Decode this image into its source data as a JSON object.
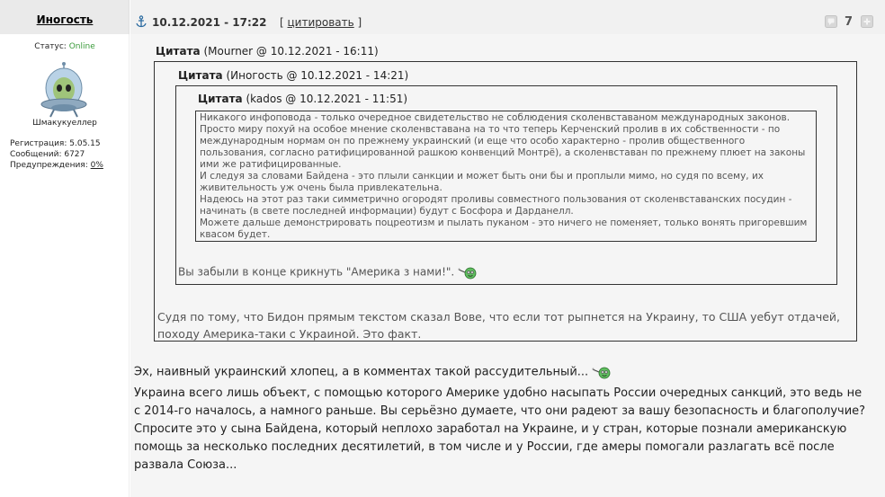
{
  "author": {
    "name": "Иногость",
    "status_label": "Статус:",
    "status_value": "Online",
    "nick": "Шмакукуеллер",
    "reg_label": "Регистрация:",
    "reg_value": "5.05.15",
    "posts_label": "Сообщений:",
    "posts_value": "6727",
    "warn_label": "Предупреждения:",
    "warn_value": "0%"
  },
  "post_header": {
    "date": "10.12.2021 - 17:22",
    "bracket_open": "[",
    "quote_link": "цитировать",
    "bracket_close": "]",
    "rating": "7"
  },
  "quote1": {
    "label": "Цитата",
    "meta": "(Mourner @ 10.12.2021 - 16:11)",
    "text": "Судя по тому, что Бидон прямым текстом сказал Вове, что если тот рыпнется на Украину, то США уебут отдачей, походу Америка-таки с Украиной. Это факт."
  },
  "quote2": {
    "label": "Цитата",
    "meta": "(Иногость @ 10.12.2021 - 14:21)",
    "text": "Вы забыли в конце крикнуть \"Америка з нами!\"."
  },
  "quote3": {
    "label": "Цитата",
    "meta": "(kados @ 10.12.2021 - 11:51)",
    "lines": [
      "Никакого инфоповода - только очередное свидетельство не соблюдения сколенвставаном международных законов.",
      "Просто миру похуй на особое мнение сколенвставана на то что теперь Керченский пролив в их собственности - по международным нормам он по прежнему украинский (и еще что особо характерно - пролив общественного пользования, согласно ратифицированной рашкою конвенций Монтрё), а сколенвставан по прежнему плюет на законы ими же ратифицированные.",
      "И следуя за словами Байдена - это плыли санкции и может быть они бы и проплыли мимо, но судя по всему, их живительность уж очень была привлекательна.",
      "Надеюсь на этот раз таки симметрично огородят проливы совместного пользования от сколенвставанских посудин - начинать (в свете последней информации) будут с Босфора и Дарданелл.",
      "Можете дальше демонстрировать поцреотизм и пылать пуканом - это ничего не поменяет, только вонять пригоревшим квасом будет."
    ]
  },
  "reply": {
    "line1": "Эх, наивный украинский хлопец, а в комментах такой рассудительный...",
    "paragraph1": "Украина всего лишь объект, с помощью которого Америке удобно насыпать России очередных санкций, это ведь не с 2014-го началось, а намного раньше. Вы серьёзно думаете, что они радеют за вашу безопасность и благополучие?",
    "paragraph2": "Спросите это у сына Байдена, который неплохо заработал на Украине, и у стран, которые познали американскую помощь за несколько последних десятилетий, в том числе и у России, где амеры помогали разлагать всё после развала Союза..."
  },
  "colors": {
    "online": "#3a9a3a",
    "header_bg": "#f1f1f1",
    "content_bg": "#f5f5f5"
  },
  "icons": [
    "anchor-icon",
    "alien-ufo-avatar",
    "report-icon",
    "plus-icon",
    "smoking-smiley-icon"
  ]
}
